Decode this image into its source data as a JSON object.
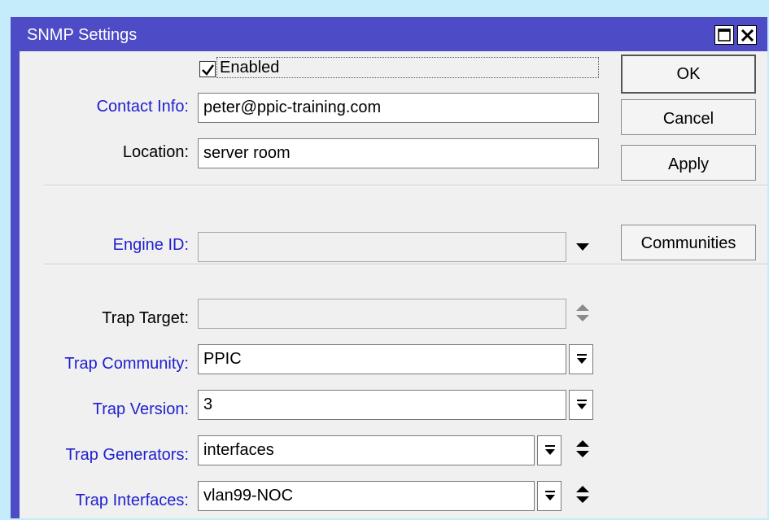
{
  "window": {
    "title": "SNMP Settings"
  },
  "form": {
    "enabled_label": "Enabled",
    "enabled_checked": true,
    "contact_info": {
      "label": "Contact Info:",
      "value": "peter@ppic-training.com"
    },
    "location": {
      "label": "Location:",
      "value": "server room"
    },
    "engine_id": {
      "label": "Engine ID:",
      "value": ""
    },
    "trap_target": {
      "label": "Trap Target:",
      "value": ""
    },
    "trap_community": {
      "label": "Trap Community:",
      "value": "PPIC"
    },
    "trap_version": {
      "label": "Trap Version:",
      "value": "3"
    },
    "trap_generators": {
      "label": "Trap Generators:",
      "value": "interfaces"
    },
    "trap_interfaces": {
      "label": "Trap Interfaces:",
      "value": "vlan99-NOC"
    }
  },
  "buttons": {
    "ok": "OK",
    "cancel": "Cancel",
    "apply": "Apply",
    "communities": "Communities"
  },
  "icons": {
    "maximize": "maximize-icon",
    "close": "close-icon",
    "checkmark": "checkmark-icon",
    "dropdown": "triangle-down-icon",
    "up_down": "up-down-arrows-icon",
    "select": "select-down-icon"
  },
  "colors": {
    "titlebar": "#4d4cc6",
    "background": "#c4ecfb",
    "client": "#f0f0f0",
    "link_label": "#1f1fcf"
  }
}
